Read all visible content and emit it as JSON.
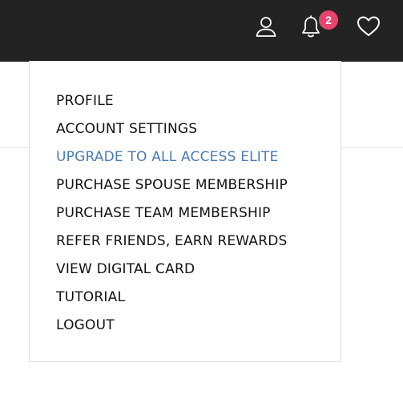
{
  "header": {
    "icons": {
      "account": "user-icon",
      "notifications": "bell-icon",
      "favorites": "heart-icon"
    },
    "notification_count": "2",
    "colors": {
      "bar": "#232323",
      "badge": "#e8436e"
    }
  },
  "account_menu": {
    "items": [
      {
        "label": "PROFILE"
      },
      {
        "label": "ACCOUNT SETTINGS"
      },
      {
        "label": "UPGRADE TO ALL ACCESS ELITE"
      },
      {
        "label": "PURCHASE SPOUSE MEMBERSHIP"
      },
      {
        "label": "PURCHASE TEAM MEMBERSHIP"
      },
      {
        "label": "REFER FRIENDS, EARN REWARDS"
      },
      {
        "label": "VIEW DIGITAL CARD"
      },
      {
        "label": "TUTORIAL"
      },
      {
        "label": "LOGOUT"
      }
    ],
    "highlight_color": "#4a7bb0"
  }
}
